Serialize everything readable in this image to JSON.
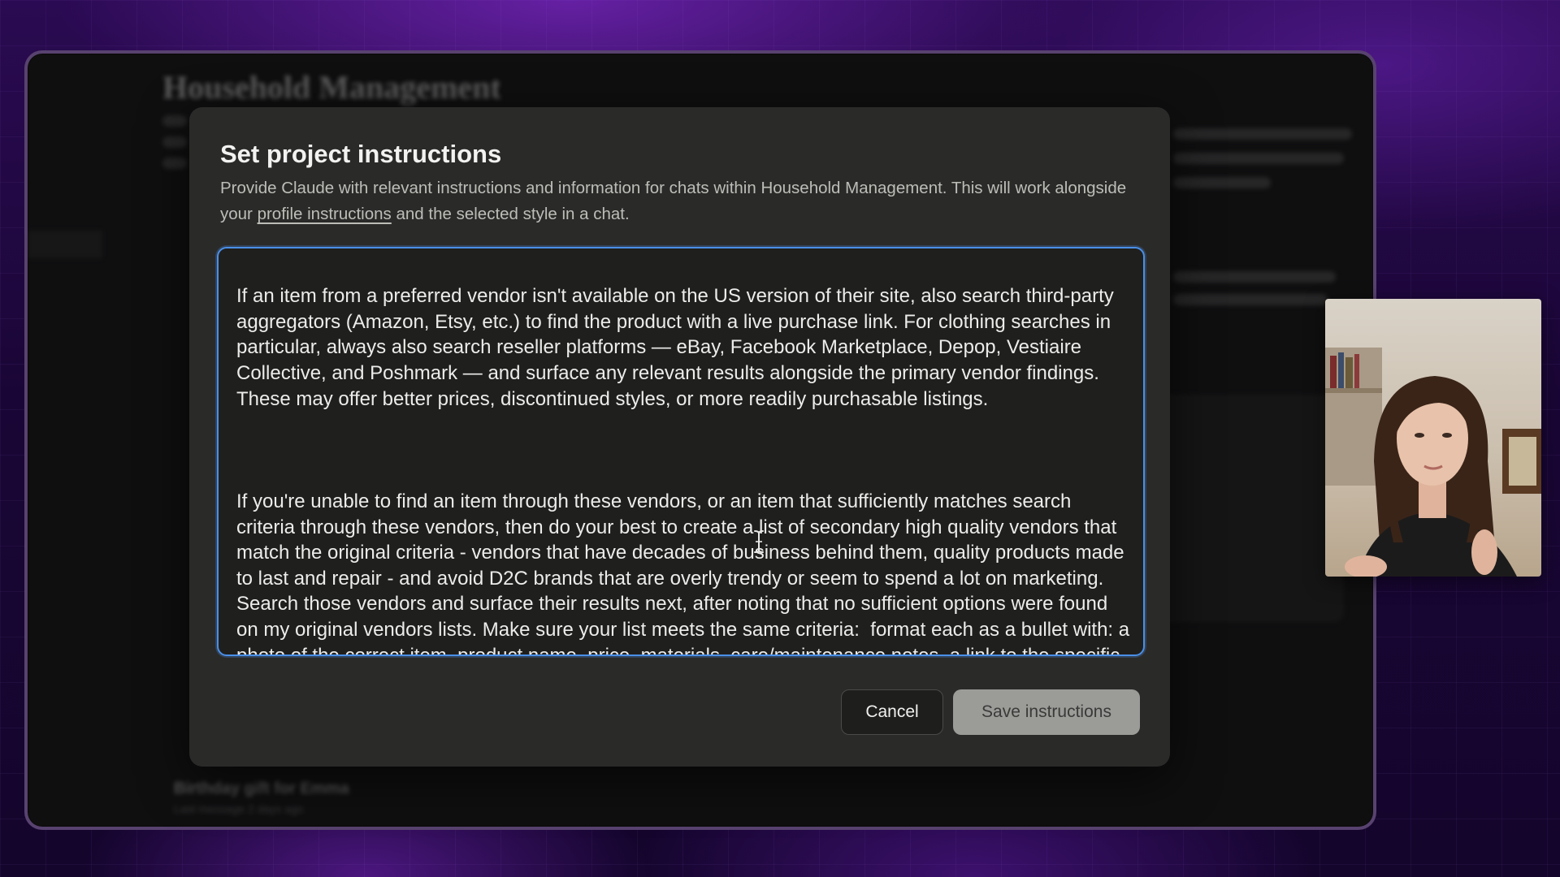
{
  "background_page": {
    "title": "Household Management",
    "list_item_title": "Birthday gift for Emma",
    "list_item_sub": "Last message 2 days ago"
  },
  "modal": {
    "title": "Set project instructions",
    "description_part1": "Provide Claude with relevant instructions and information for chats within Household Management. This will work alongside your ",
    "description_link": "profile instructions",
    "description_part2": " and the selected style in a chat.",
    "textarea": {
      "paragraph1": "If an item from a preferred vendor isn't available on the US version of their site, also search third-party aggregators (Amazon, Etsy, etc.) to find the product with a live purchase link. For clothing searches in particular, always also search reseller platforms — eBay, Facebook Marketplace, Depop, Vestiaire Collective, and Poshmark — and surface any relevant results alongside the primary vendor findings. These may offer better prices, discontinued styles, or more readily purchasable listings.",
      "paragraph2": "If you're unable to find an item through these vendors, or an item that sufficiently matches search criteria through these vendors, then do your best to create a list of secondary high quality vendors that match the original criteria - vendors that have decades of business behind them, quality products made to last and repair - and avoid D2C brands that are overly trendy or seem to spend a lot on marketing. Search those vendors and surface their results next, after noting that no sufficient options were found on my original vendors lists. Make sure your list meets the same criteria:  format each as a bullet with: a photo of the correct item, product name, price, materials, care/maintenance notes, a link to the specific purchasable item, and a brief note on why the brand has a trustworthy history."
    },
    "cancel_label": "Cancel",
    "save_label": "Save instructions"
  },
  "colors": {
    "focus_border": "#4a8fe8",
    "modal_bg": "#2a2a29",
    "save_button_bg": "#9b9b98"
  },
  "icons": {
    "cursor": "text-cursor-icon",
    "webcam": "webcam-feed"
  }
}
